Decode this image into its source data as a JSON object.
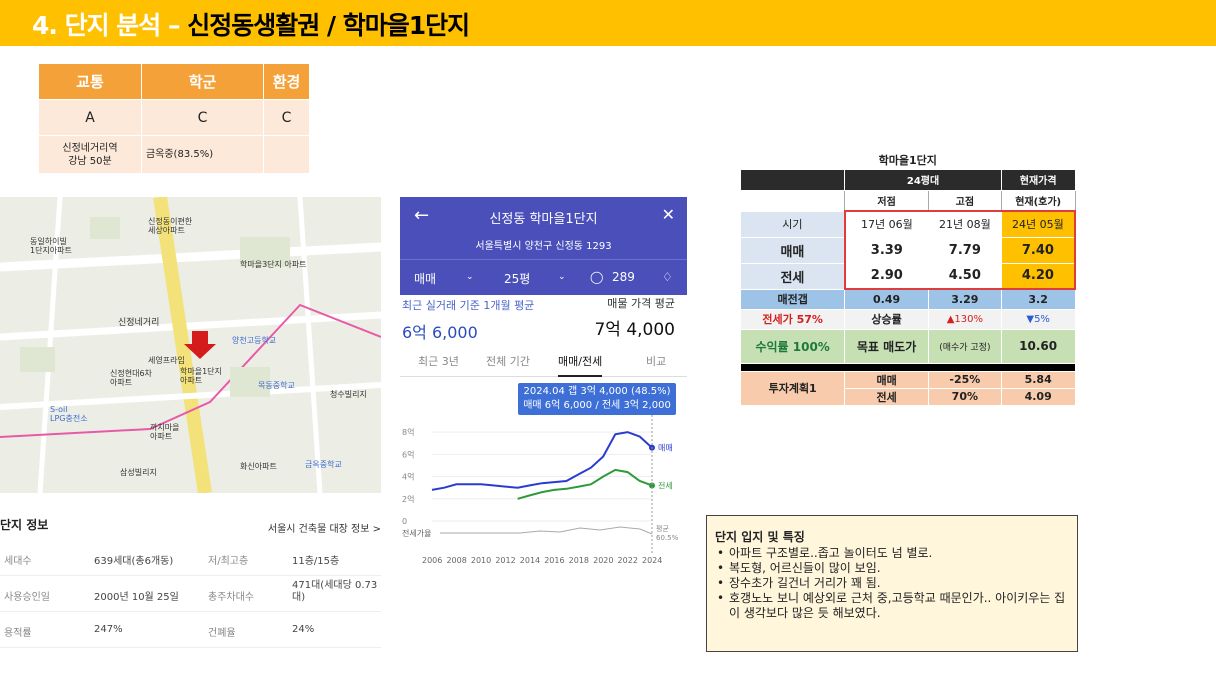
{
  "header": {
    "title": "4. 단지 분석 – ",
    "subtitle": "신정동생활권 /  학마을1단지"
  },
  "rating": {
    "headers": [
      "교통",
      "학군",
      "환경"
    ],
    "grades": [
      "A",
      "C",
      "C"
    ],
    "descriptions": [
      "신정네거리역\n강남 50분",
      "금옥중(83.5%)",
      ""
    ]
  },
  "map": {
    "labels": {
      "station": "신정네거리",
      "complex": "학마을1단지\n아파트",
      "school": "양천고등학교",
      "school2": "목동중학교",
      "apt1": "신정동이편한\n세상아파트",
      "apt2": "동일하이빌\n1단지아파트",
      "apt3": "학마을3단지\n아파트",
      "oil": "S-oil\nLPG충전소",
      "kkachi": "까치마을\n아파트",
      "cheongsu": "청수빌리지",
      "geumok": "금옥중학교",
      "sewon": "세영프라임",
      "hwasin": "화신아파트",
      "samsung": "삼성빌리지",
      "ssangyong": "신정현대6차\n아파트"
    }
  },
  "complex_info": {
    "heading": "단지 정보",
    "link_label": "서울시 건축물 대장 정보 >",
    "rows": [
      {
        "k1": "세대수",
        "v1": "639세대(총6개동)",
        "k2": "저/최고층",
        "v2": "11층/15층"
      },
      {
        "k1": "사용승인일",
        "v1": "2000년 10월 25일",
        "k2": "총주차대수",
        "v2": "471대(세대당 0.73대)"
      },
      {
        "k1": "용적률",
        "v1": "247%",
        "k2": "건폐율",
        "v2": "24%"
      }
    ]
  },
  "app": {
    "back_icon": "arrow-left-icon",
    "name": "신정동 학마을1단지",
    "address": "서울특별시 양천구 신정동 1293",
    "filter_type": "매매",
    "filter_size": "25평",
    "count": "289",
    "label_recent": "최근 실거래 기준 1개월 평균",
    "label_listing": "매물 가격 평균",
    "value_recent": "6억 6,000",
    "value_listing": "7억 4,000",
    "tabs": [
      "최근 3년",
      "전체 기간",
      "매매/전세",
      "비교"
    ],
    "tooltip_line1": "2024.04  갭 3억 4,000 (48.5%)",
    "tooltip_line2": "매매 6억 6,000 / 전세 3억 2,000"
  },
  "chart_data": {
    "type": "line",
    "x": [
      2006,
      2007,
      2008,
      2009,
      2010,
      2011,
      2012,
      2013,
      2014,
      2015,
      2016,
      2017,
      2018,
      2019,
      2020,
      2021,
      2022,
      2023,
      2024
    ],
    "series": [
      {
        "name": "매매",
        "values": [
          2.8,
          3.0,
          3.3,
          3.3,
          3.3,
          3.2,
          3.1,
          3.0,
          3.2,
          3.4,
          3.5,
          3.6,
          4.2,
          4.8,
          5.8,
          7.8,
          8.0,
          7.6,
          6.6
        ]
      },
      {
        "name": "전세",
        "values": [
          null,
          null,
          null,
          null,
          null,
          null,
          null,
          2.0,
          2.3,
          2.6,
          2.8,
          2.9,
          3.1,
          3.3,
          4.0,
          4.6,
          4.4,
          3.6,
          3.2
        ]
      }
    ],
    "yticks": [
      "8억",
      "6억",
      "4억",
      "2억",
      "0"
    ],
    "xticks": [
      "2006",
      "2008",
      "2010",
      "2012",
      "2014",
      "2016",
      "2018",
      "2020",
      "2022",
      "2024"
    ],
    "ylim": [
      0,
      9
    ],
    "bottom_label": "전세가율",
    "bottom_value": "평균\n60.5%"
  },
  "price_table": {
    "title": "학마을1단지",
    "size": "24평대",
    "current_header": "현재가격",
    "cols": [
      "저점",
      "고점",
      "현재(호가)"
    ],
    "row_time": {
      "label": "시기",
      "values": [
        "17년 06월",
        "21년 08월",
        "24년 05월"
      ]
    },
    "row_sale": {
      "label": "매매",
      "values": [
        "3.39",
        "7.79",
        "7.40"
      ]
    },
    "row_jeonse": {
      "label": "전세",
      "values": [
        "2.90",
        "4.50",
        "4.20"
      ]
    },
    "row_gap": {
      "label": "매전갭",
      "values": [
        "0.49",
        "3.29",
        "3.2"
      ]
    },
    "row_rate": {
      "label": "전세가 57%",
      "sub": "상승률",
      "up": "▲130%",
      "down": "▼5%"
    },
    "row_yield": {
      "label": "수익률 100%",
      "sub": "목표 매도가",
      "note": "(매수가 고정)",
      "value": "10.60"
    },
    "plan": {
      "label": "투자계획1",
      "rows": [
        {
          "k": "매매",
          "pct": "-25%",
          "v": "5.84"
        },
        {
          "k": "전세",
          "pct": "70%",
          "v": "4.09"
        }
      ]
    },
    "colors": {
      "current": "#ffc000",
      "border_red": "#e03c3c"
    }
  },
  "note": {
    "title": "단지 입지 및 특징",
    "items": [
      "아파트 구조별로..좁고 놀이터도 넘 별로.",
      "복도형, 어르신들이 많이 보임.",
      "장수초가 길건너 거리가 꽤 됨.",
      "호갱노노 보니 예상외로 근처 중,고등학교 때문인가.. 아이키우는 집이 생각보다 많은 듯 해보였다."
    ]
  }
}
